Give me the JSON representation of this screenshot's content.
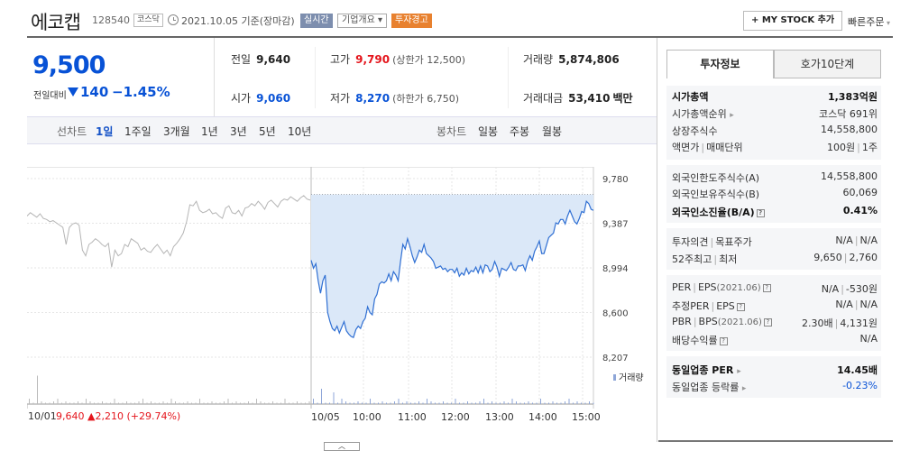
{
  "header": {
    "stock_name": "에코캡",
    "stock_code": "128540",
    "market": "코스닥",
    "date_text": "2021.10.05 기준(장마감)",
    "btn_realtime": "실시간",
    "btn_company": "기업개요 ▾",
    "btn_warning": "투자경고",
    "btn_mystock": "+ MY STOCK 추가",
    "btn_quick_order": "빠른주문"
  },
  "price": {
    "current": "9,500",
    "diff_label": "전일대비",
    "diff_value": "140",
    "diff_rate": "−1.45%"
  },
  "quotes": {
    "prev_close": {
      "label": "전일",
      "value": "9,640"
    },
    "high": {
      "label": "고가",
      "value": "9,790",
      "sub": "(상한가 12,500)"
    },
    "volume": {
      "label": "거래량",
      "value": "5,874,806"
    },
    "open": {
      "label": "시가",
      "value": "9,060"
    },
    "low": {
      "label": "저가",
      "value": "8,270",
      "sub": "(하한가 6,750)"
    },
    "amount": {
      "label": "거래대금",
      "value": "53,410",
      "unit": "백만"
    }
  },
  "chart_tabs": {
    "line_label": "선차트",
    "line_tabs": [
      "1일",
      "1주일",
      "3개월",
      "1년",
      "3년",
      "5년",
      "10년"
    ],
    "active": "1일",
    "candle_label": "봉차트",
    "candle_tabs": [
      "일봉",
      "주봉",
      "월봉"
    ]
  },
  "right_panel": {
    "tab_on": "투자정보",
    "tab_off": "호가10단계",
    "rows_1": [
      {
        "label": "시가총액",
        "value": "1,383억원",
        "bold": true
      },
      {
        "label": "시가총액순위",
        "value": "코스닥 691위"
      },
      {
        "label": "상장주식수",
        "value": "14,558,800"
      },
      {
        "label": "액면가",
        "label2": "매매단위",
        "value": "100원",
        "value2": "1주"
      }
    ],
    "rows_2": [
      {
        "label": "외국인한도주식수(A)",
        "value": "14,558,800"
      },
      {
        "label": "외국인보유주식수(B)",
        "value": "60,069"
      },
      {
        "label": "외국인소진율(B/A)",
        "value": "0.41%",
        "bold": true
      }
    ],
    "rows_3": [
      {
        "label": "투자의견",
        "label2": "목표주가",
        "value": "N/A",
        "value2": "N/A"
      },
      {
        "label": "52주최고",
        "label2": "최저",
        "value": "9,650",
        "value2": "2,760"
      }
    ],
    "rows_4": [
      {
        "label": "PER",
        "label2": "EPS",
        "date": "(2021.06)",
        "value": "N/A",
        "value2": "-530원"
      },
      {
        "label": "추정PER",
        "label2": "EPS",
        "value": "N/A",
        "value2": "N/A"
      },
      {
        "label": "PBR",
        "label2": "BPS",
        "date": "(2021.06)",
        "value": "2.30배",
        "value2": "4,131원"
      },
      {
        "label": "배당수익률",
        "value": "N/A"
      }
    ],
    "rows_5": [
      {
        "label": "동일업종 PER",
        "value": "14.45배",
        "bold": true
      },
      {
        "label": "동일업종 등락률",
        "value": "-0.23%"
      }
    ]
  },
  "chart_data": {
    "type": "line",
    "y_ticks": [
      "9,780",
      "9,387",
      "8,994",
      "8,600",
      "8,207"
    ],
    "ylim": [
      8207,
      9780
    ],
    "volume_legend": "거래량",
    "prev_label_date": "10/01",
    "prev_label_value": "9,640",
    "prev_label_change": "▲2,210 (+29.74%)",
    "x_ticks": [
      "10/05",
      "10:00",
      "11:00",
      "12:00",
      "13:00",
      "14:00",
      "15:00"
    ],
    "prev_day_series": [
      9450,
      9480,
      9460,
      9440,
      9470,
      9430,
      9420,
      9400,
      9410,
      9390,
      9370,
      9350,
      9200,
      9350,
      9380,
      9390,
      9370,
      9150,
      9100,
      9200,
      9220,
      9250,
      9230,
      9200,
      9180,
      9210,
      9000,
      9150,
      9100,
      9120,
      9200,
      9180,
      9250,
      9230,
      9210,
      9150,
      9170,
      9140,
      9130,
      9170,
      9200,
      9160,
      9120,
      9150,
      9100,
      9180,
      9210,
      9250,
      9300,
      9400,
      9550,
      9540,
      9580,
      9500,
      9480,
      9490,
      9510,
      9470,
      9480,
      9450,
      9430,
      9520,
      9540,
      9480,
      9470,
      9500,
      9450,
      9520,
      9530,
      9560,
      9540,
      9580,
      9550,
      9510,
      9570,
      9590,
      9560,
      9530,
      9580,
      9600,
      9590,
      9620,
      9600,
      9580,
      9610,
      9630,
      9600,
      9590
    ],
    "today_series": [
      9060,
      8990,
      9030,
      8880,
      8770,
      8880,
      8930,
      8600,
      8520,
      8460,
      8440,
      8480,
      8420,
      8470,
      8520,
      8440,
      8410,
      8390,
      8380,
      8450,
      8480,
      8460,
      8520,
      8550,
      8650,
      8600,
      8580,
      8720,
      8760,
      8850,
      8870,
      8860,
      8880,
      8940,
      8880,
      8960,
      8930,
      8880,
      9050,
      9200,
      9160,
      9250,
      9180,
      9100,
      9040,
      9090,
      9150,
      9130,
      9200,
      9120,
      9100,
      9080,
      9050,
      8990,
      9000,
      9010,
      8980,
      8990,
      8960,
      8980,
      8980,
      8950,
      8990,
      8920,
      8950,
      8930,
      8990,
      8940,
      8970,
      8960,
      9000,
      8950,
      9010,
      8950,
      9020,
      9010,
      8960,
      8980,
      9050,
      9000,
      8920,
      8990,
      8980,
      8970,
      9000,
      9040,
      8980,
      8970,
      9010,
      9010,
      9020,
      8970,
      9050,
      9100,
      9060,
      9140,
      9180,
      9230,
      9120,
      9120,
      9190,
      9260,
      9280,
      9300,
      9390,
      9380,
      9420,
      9420,
      9380,
      9450,
      9500,
      9450,
      9400,
      9380,
      9430,
      9490,
      9480,
      9580,
      9560,
      9510,
      9500
    ]
  }
}
